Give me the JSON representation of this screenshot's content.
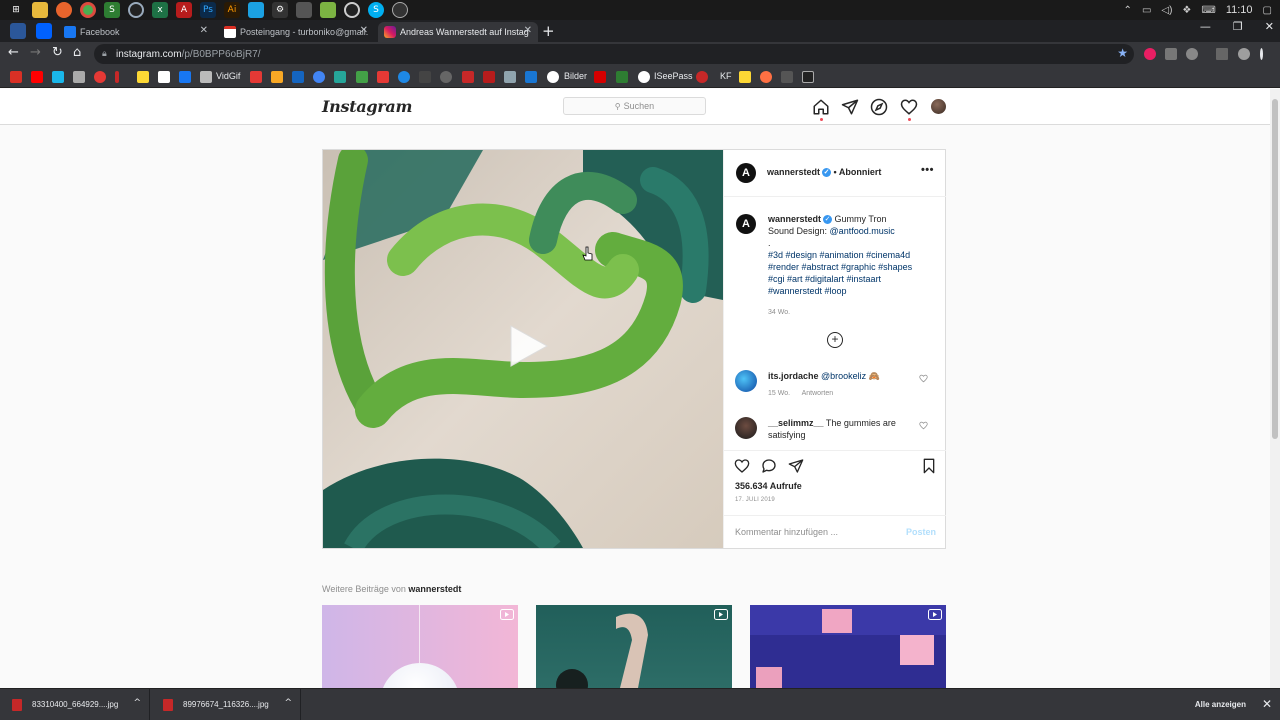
{
  "colors": {
    "accent": "#3897f0",
    "link": "#003569",
    "notification": "#ed4956",
    "chrome_dark": "#35363a"
  },
  "taskbar": {
    "clock": "11:10",
    "pinned_icons": [
      "windows-icon",
      "file-explorer-icon",
      "firefox-icon",
      "chrome-icon",
      "stash-icon",
      "opera-icon",
      "excel-icon",
      "acrobat-icon",
      "photoshop-icon",
      "illustrator-icon",
      "app-icon",
      "tool-icon",
      "image-icon",
      "map-icon",
      "chrome-alt-icon",
      "skype-icon",
      "obs-icon"
    ]
  },
  "browser": {
    "tabs": [
      {
        "label": "Facebook",
        "active": false
      },
      {
        "label": "Posteingang - turboniko@gmail.",
        "active": false
      },
      {
        "label": "Andreas Wannerstedt auf Instag",
        "active": true
      }
    ],
    "url_host": "instagram.com",
    "url_path": "/p/B0BPP6oBjR7/",
    "bookmarks": {
      "vidgif": "VidGif",
      "bilder": "Bilder",
      "iseepass": "ISeePass",
      "kf": "KF"
    }
  },
  "instagram": {
    "logo": "Instagram",
    "search_placeholder": "Suchen",
    "post": {
      "username": "wannerstedt",
      "follow_status": "• Abonniert",
      "avatar_letter": "A",
      "caption": {
        "title": "Gummy Tron",
        "sound_label": "Sound Design: ",
        "sound_link": "@antfood.music",
        "dot": ".",
        "hashtags_1": "#3d #design #animation #cinema4d",
        "hashtags_2": "#render #abstract #graphic #shapes",
        "hashtags_3": "#cgi #art #digitalart #instaart",
        "hashtags_4": "#wannerstedt #loop",
        "time": "34 Wo."
      },
      "comments": [
        {
          "user": "its.jordache",
          "mention": "@brookeliz",
          "emoji": "🙈",
          "time": "15 Wo.",
          "reply": "Antworten"
        },
        {
          "user": "__selimmz__",
          "text": "The gummies are satisfying"
        }
      ],
      "views": "356.634 Aufrufe",
      "date": "17. JULI 2019",
      "comment_placeholder": "Kommentar hinzufügen ...",
      "post_button": "Posten"
    },
    "more": {
      "prefix": "Weitere Beiträge von ",
      "username": "wannerstedt"
    }
  },
  "downloads": {
    "items": [
      "83310400_664929....jpg",
      "89976674_116326....jpg"
    ],
    "show_all": "Alle anzeigen"
  }
}
